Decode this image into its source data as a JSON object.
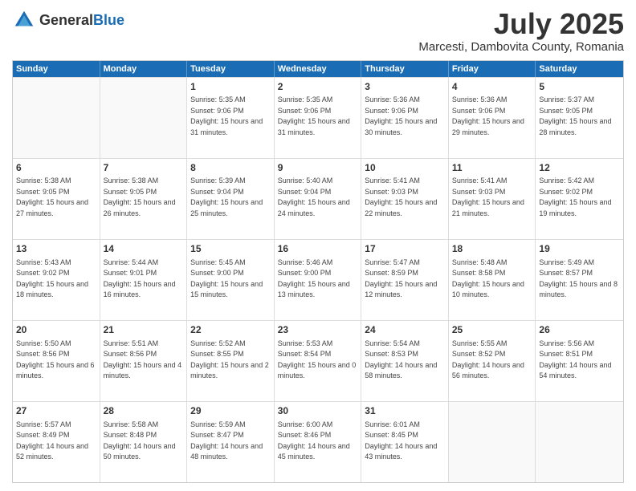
{
  "header": {
    "logo_general": "General",
    "logo_blue": "Blue",
    "title": "July 2025",
    "subtitle": "Marcesti, Dambovita County, Romania"
  },
  "days_of_week": [
    "Sunday",
    "Monday",
    "Tuesday",
    "Wednesday",
    "Thursday",
    "Friday",
    "Saturday"
  ],
  "weeks": [
    {
      "cells": [
        {
          "day": "",
          "empty": true
        },
        {
          "day": "",
          "empty": true
        },
        {
          "day": "1",
          "sunrise": "Sunrise: 5:35 AM",
          "sunset": "Sunset: 9:06 PM",
          "daylight": "Daylight: 15 hours and 31 minutes."
        },
        {
          "day": "2",
          "sunrise": "Sunrise: 5:35 AM",
          "sunset": "Sunset: 9:06 PM",
          "daylight": "Daylight: 15 hours and 31 minutes."
        },
        {
          "day": "3",
          "sunrise": "Sunrise: 5:36 AM",
          "sunset": "Sunset: 9:06 PM",
          "daylight": "Daylight: 15 hours and 30 minutes."
        },
        {
          "day": "4",
          "sunrise": "Sunrise: 5:36 AM",
          "sunset": "Sunset: 9:06 PM",
          "daylight": "Daylight: 15 hours and 29 minutes."
        },
        {
          "day": "5",
          "sunrise": "Sunrise: 5:37 AM",
          "sunset": "Sunset: 9:05 PM",
          "daylight": "Daylight: 15 hours and 28 minutes."
        }
      ]
    },
    {
      "cells": [
        {
          "day": "6",
          "sunrise": "Sunrise: 5:38 AM",
          "sunset": "Sunset: 9:05 PM",
          "daylight": "Daylight: 15 hours and 27 minutes."
        },
        {
          "day": "7",
          "sunrise": "Sunrise: 5:38 AM",
          "sunset": "Sunset: 9:05 PM",
          "daylight": "Daylight: 15 hours and 26 minutes."
        },
        {
          "day": "8",
          "sunrise": "Sunrise: 5:39 AM",
          "sunset": "Sunset: 9:04 PM",
          "daylight": "Daylight: 15 hours and 25 minutes."
        },
        {
          "day": "9",
          "sunrise": "Sunrise: 5:40 AM",
          "sunset": "Sunset: 9:04 PM",
          "daylight": "Daylight: 15 hours and 24 minutes."
        },
        {
          "day": "10",
          "sunrise": "Sunrise: 5:41 AM",
          "sunset": "Sunset: 9:03 PM",
          "daylight": "Daylight: 15 hours and 22 minutes."
        },
        {
          "day": "11",
          "sunrise": "Sunrise: 5:41 AM",
          "sunset": "Sunset: 9:03 PM",
          "daylight": "Daylight: 15 hours and 21 minutes."
        },
        {
          "day": "12",
          "sunrise": "Sunrise: 5:42 AM",
          "sunset": "Sunset: 9:02 PM",
          "daylight": "Daylight: 15 hours and 19 minutes."
        }
      ]
    },
    {
      "cells": [
        {
          "day": "13",
          "sunrise": "Sunrise: 5:43 AM",
          "sunset": "Sunset: 9:02 PM",
          "daylight": "Daylight: 15 hours and 18 minutes."
        },
        {
          "day": "14",
          "sunrise": "Sunrise: 5:44 AM",
          "sunset": "Sunset: 9:01 PM",
          "daylight": "Daylight: 15 hours and 16 minutes."
        },
        {
          "day": "15",
          "sunrise": "Sunrise: 5:45 AM",
          "sunset": "Sunset: 9:00 PM",
          "daylight": "Daylight: 15 hours and 15 minutes."
        },
        {
          "day": "16",
          "sunrise": "Sunrise: 5:46 AM",
          "sunset": "Sunset: 9:00 PM",
          "daylight": "Daylight: 15 hours and 13 minutes."
        },
        {
          "day": "17",
          "sunrise": "Sunrise: 5:47 AM",
          "sunset": "Sunset: 8:59 PM",
          "daylight": "Daylight: 15 hours and 12 minutes."
        },
        {
          "day": "18",
          "sunrise": "Sunrise: 5:48 AM",
          "sunset": "Sunset: 8:58 PM",
          "daylight": "Daylight: 15 hours and 10 minutes."
        },
        {
          "day": "19",
          "sunrise": "Sunrise: 5:49 AM",
          "sunset": "Sunset: 8:57 PM",
          "daylight": "Daylight: 15 hours and 8 minutes."
        }
      ]
    },
    {
      "cells": [
        {
          "day": "20",
          "sunrise": "Sunrise: 5:50 AM",
          "sunset": "Sunset: 8:56 PM",
          "daylight": "Daylight: 15 hours and 6 minutes."
        },
        {
          "day": "21",
          "sunrise": "Sunrise: 5:51 AM",
          "sunset": "Sunset: 8:56 PM",
          "daylight": "Daylight: 15 hours and 4 minutes."
        },
        {
          "day": "22",
          "sunrise": "Sunrise: 5:52 AM",
          "sunset": "Sunset: 8:55 PM",
          "daylight": "Daylight: 15 hours and 2 minutes."
        },
        {
          "day": "23",
          "sunrise": "Sunrise: 5:53 AM",
          "sunset": "Sunset: 8:54 PM",
          "daylight": "Daylight: 15 hours and 0 minutes."
        },
        {
          "day": "24",
          "sunrise": "Sunrise: 5:54 AM",
          "sunset": "Sunset: 8:53 PM",
          "daylight": "Daylight: 14 hours and 58 minutes."
        },
        {
          "day": "25",
          "sunrise": "Sunrise: 5:55 AM",
          "sunset": "Sunset: 8:52 PM",
          "daylight": "Daylight: 14 hours and 56 minutes."
        },
        {
          "day": "26",
          "sunrise": "Sunrise: 5:56 AM",
          "sunset": "Sunset: 8:51 PM",
          "daylight": "Daylight: 14 hours and 54 minutes."
        }
      ]
    },
    {
      "cells": [
        {
          "day": "27",
          "sunrise": "Sunrise: 5:57 AM",
          "sunset": "Sunset: 8:49 PM",
          "daylight": "Daylight: 14 hours and 52 minutes."
        },
        {
          "day": "28",
          "sunrise": "Sunrise: 5:58 AM",
          "sunset": "Sunset: 8:48 PM",
          "daylight": "Daylight: 14 hours and 50 minutes."
        },
        {
          "day": "29",
          "sunrise": "Sunrise: 5:59 AM",
          "sunset": "Sunset: 8:47 PM",
          "daylight": "Daylight: 14 hours and 48 minutes."
        },
        {
          "day": "30",
          "sunrise": "Sunrise: 6:00 AM",
          "sunset": "Sunset: 8:46 PM",
          "daylight": "Daylight: 14 hours and 45 minutes."
        },
        {
          "day": "31",
          "sunrise": "Sunrise: 6:01 AM",
          "sunset": "Sunset: 8:45 PM",
          "daylight": "Daylight: 14 hours and 43 minutes."
        },
        {
          "day": "",
          "empty": true
        },
        {
          "day": "",
          "empty": true
        }
      ]
    }
  ]
}
